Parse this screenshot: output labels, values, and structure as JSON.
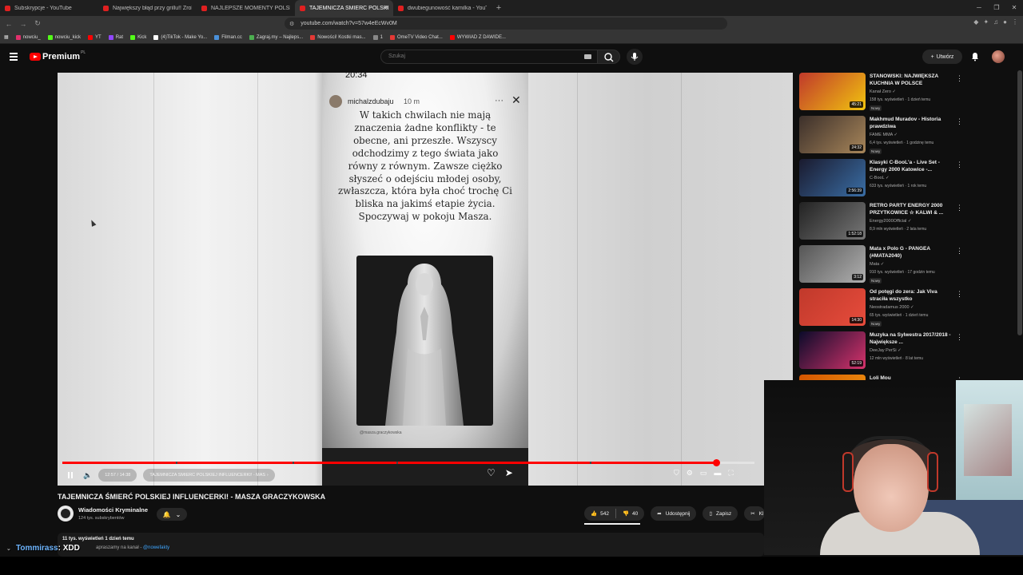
{
  "browser": {
    "tabs": [
      {
        "label": "Subskrypcje - YouTube",
        "active": false
      },
      {
        "label": "Największy błąd przy grillu!! Zrobiłem",
        "active": false
      },
      {
        "label": "NAJLEPSZE MOMENTY POLSKIEGO",
        "active": false
      },
      {
        "label": "TAJEMNICZA ŚMIERĆ POLSKI",
        "active": true
      },
      {
        "label": "dwubiegunowość kamilka - YouTube",
        "active": false
      }
    ],
    "new_tab": "+",
    "url": "youtube.com/watch?v=57w4eEcWv0M",
    "bookmarks": [
      {
        "label": "nowciu_",
        "color": "#e1306c"
      },
      {
        "label": "nowciu_kick",
        "color": "#53fc18"
      },
      {
        "label": "YT",
        "color": "#ff0000"
      },
      {
        "label": "Rat",
        "color": "#9146ff"
      },
      {
        "label": "Kick",
        "color": "#53fc18"
      },
      {
        "label": "(4)TikTok - Make Yo...",
        "color": "#ffffff"
      },
      {
        "label": "Filman.cc",
        "color": "#4a90d9"
      },
      {
        "label": "Zagraj.my – Najleps...",
        "color": "#4caf50"
      },
      {
        "label": "Nowości! Kostki mas...",
        "color": "#e53935"
      },
      {
        "label": "1",
        "color": "#888888"
      },
      {
        "label": "OmeTV Video Chat...",
        "color": "#e53935"
      },
      {
        "label": "WYWIAD Z DAWIDE...",
        "color": "#ff0000"
      }
    ]
  },
  "youtube": {
    "logo_text": "Premium",
    "logo_region": "PL",
    "search_placeholder": "Szukaj",
    "create_label": "Utwórz"
  },
  "player": {
    "time": "12:57 / 14:38",
    "chapter": "TAJEMNICZA ŚMIERĆ POLSKIEJ INFLUENCERKI! - MASZA GRACZYKOWSKA",
    "progress": 0.945,
    "story": {
      "clock": "20:34",
      "username": "michalzdubaju",
      "age": "10 m",
      "text": "W takich chwilach nie mają znaczenia żadne konflikty - te obecne, ani przeszłe. Wszyscy odchodzimy z tego świata jako równy z równym. Zawsze ciężko słyszeć o odejściu młodej osoby, zwłaszcza, która była choć trochę Ci bliska na jakimś etapie życia. Spoczywaj w pokoju Masza.",
      "credit": "@masza.graczykowska"
    }
  },
  "video": {
    "title": "TAJEMNICZA ŚMIERĆ POLSKIEJ INFLUENCERKI! - MASZA GRACZYKOWSKA",
    "channel": "Wiadomości Kryminalne",
    "subscribers": "124 tys. subskrybentów",
    "likes": "542",
    "dislikes": "40",
    "share": "Udostępnij",
    "save": "Zapisz",
    "clip": "Kl",
    "meta": "11 tys. wyświetleń  1 dzień temu",
    "desc_line_prefix": "apraszamy na kanał -",
    "desc_handle": "@nowefakty"
  },
  "chat_overlay": {
    "user": "Tommirass",
    "message": ": XDD"
  },
  "recommendations": [
    {
      "title": "STANOWSKI: NAJWIĘKSZA KUCHNIA W POLSCE",
      "channel": "Kanał Zero",
      "meta": "158 tys. wyświetleń · 1 dzień temu",
      "badge": "Nowy",
      "duration": "45:21",
      "thumb_a": "#c0392b",
      "thumb_b": "#f1c40f"
    },
    {
      "title": "Makhmud Muradov - Historia prawdziwa",
      "channel": "FAME MMA",
      "meta": "6,4 tys. wyświetleń · 1 godzinę temu",
      "badge": "Nowy",
      "duration": "24:32",
      "thumb_a": "#3b2f2a",
      "thumb_b": "#a8865a"
    },
    {
      "title": "Klasyki C-BooL'a - Live Set - Energy 2000 Katowice -...",
      "channel": "C-BooL",
      "meta": "633 tys. wyświetleń · 1 rok temu",
      "badge": "",
      "duration": "2:56:39",
      "thumb_a": "#1a1a2e",
      "thumb_b": "#3a6ea5"
    },
    {
      "title": "RETRO PARTY ENERGY 2000 PRZYTKOWICE ☆ KALWI & ...",
      "channel": "Energy2000Official",
      "meta": "8,9 mln wyświetleń · 2 lata temu",
      "badge": "",
      "duration": "1:52:18",
      "thumb_a": "#222222",
      "thumb_b": "#777777"
    },
    {
      "title": "Mata x Polo G - PANGEA (#MATA2040)",
      "channel": "Mata",
      "meta": "910 tys. wyświetleń · 17 godzin temu",
      "badge": "Nowy",
      "duration": "3:12",
      "thumb_a": "#555555",
      "thumb_b": "#b0b0b0"
    },
    {
      "title": "Od potęgi do zera: Jak Viva straciła wszystko",
      "channel": "Neostradamus 2000",
      "meta": "65 tys. wyświetleń · 1 dzień temu",
      "badge": "Nowy",
      "duration": "14:30",
      "thumb_a": "#c0392b",
      "thumb_b": "#e74c3c"
    },
    {
      "title": "Muzyka na Sylwestra 2017/2018 - Największe ...",
      "channel": "DeeJay PerSi",
      "meta": "12 mln wyświetleń · 8 lat temu",
      "badge": "",
      "duration": "52:19",
      "thumb_a": "#0b0b2a",
      "thumb_b": "#d6336c"
    },
    {
      "title": "Loli Mou",
      "channel": "",
      "meta": "",
      "badge": "",
      "duration": "",
      "thumb_a": "#d35400",
      "thumb_b": "#f39c12"
    }
  ]
}
